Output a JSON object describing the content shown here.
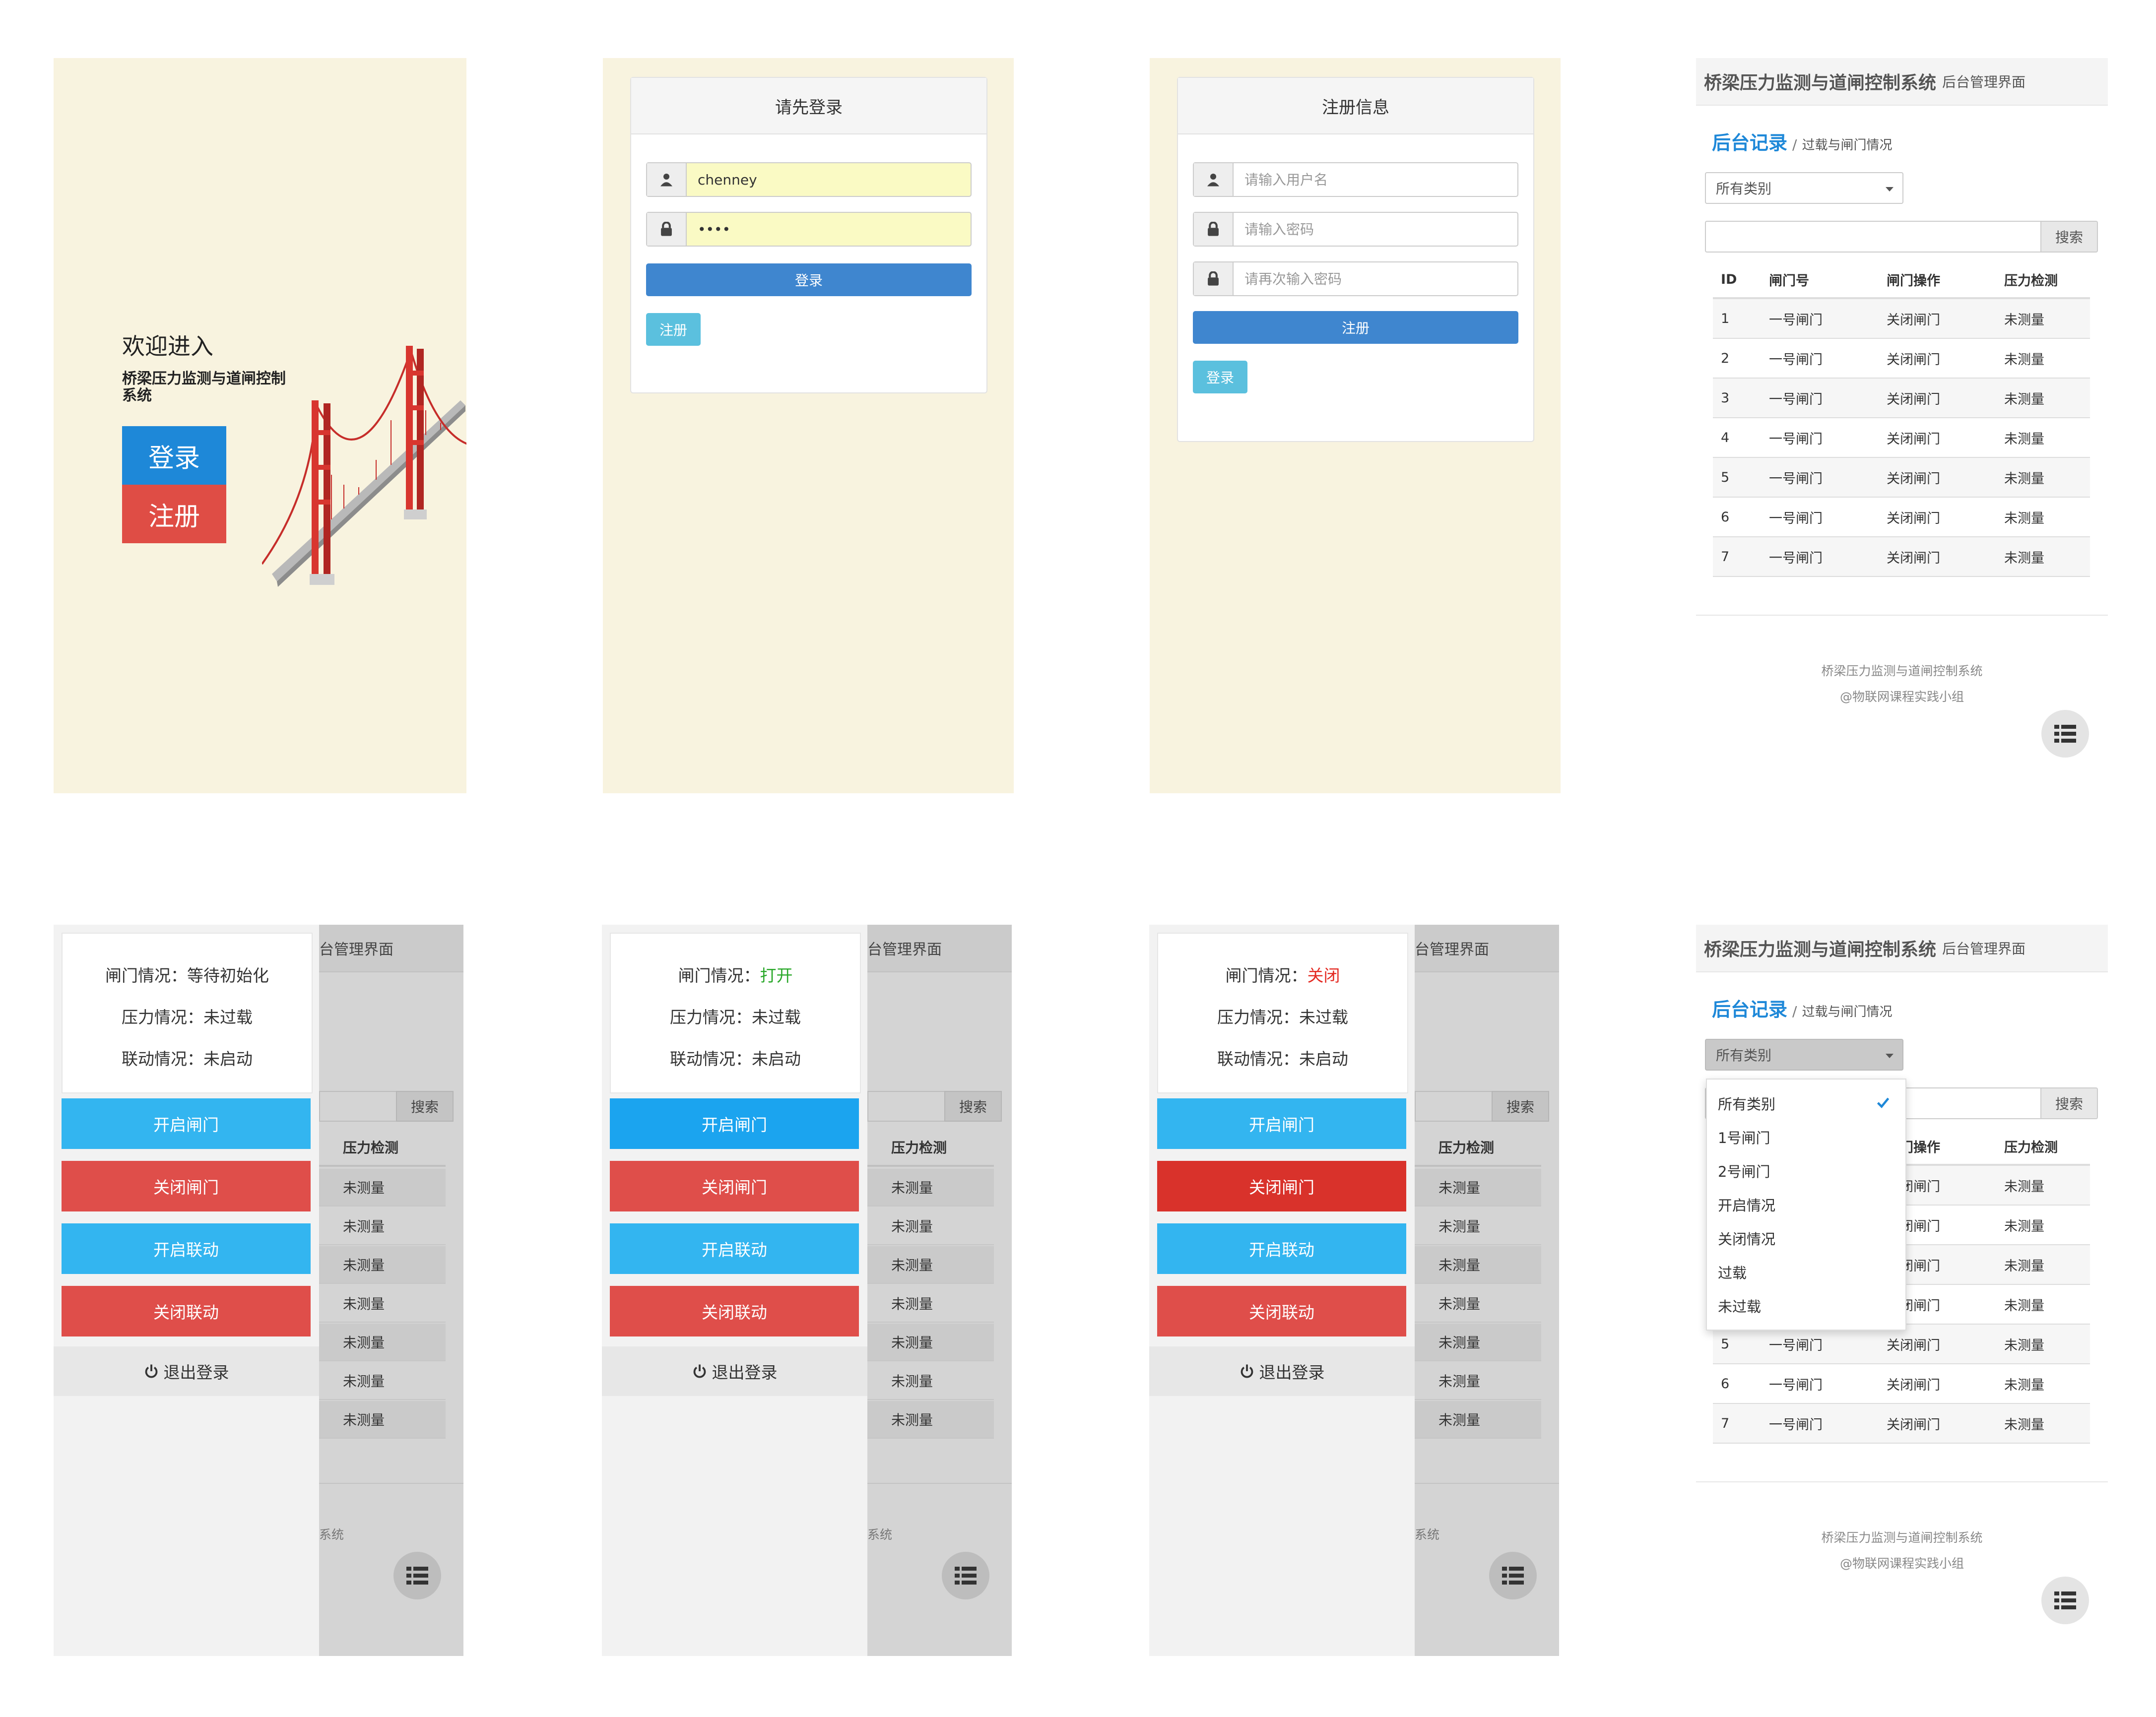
{
  "colors": {
    "accent_blue": "#1e88d8",
    "danger_red": "#df4e4a",
    "cream_bg": "#f8f3df",
    "green_open": "#2aa82a",
    "red_closed": "#e42a22"
  },
  "welcome": {
    "title": "欢迎进入",
    "subtitle": "桥梁压力监测与道闸控制系统",
    "login": "登录",
    "register": "注册"
  },
  "login": {
    "title": "请先登录",
    "user_icon": "user-icon",
    "username": "chenney",
    "password": "••••",
    "submit": "登录",
    "register": "注册"
  },
  "register": {
    "title": "注册信息",
    "username_ph": "请输入用户名",
    "password_ph": "请输入密码",
    "password2_ph": "请再次输入密码",
    "submit": "注册",
    "login": "登录"
  },
  "admin": {
    "app_title": "桥梁压力监测与道闸控制系统",
    "app_sub": "后台管理界面",
    "crumb_main": "后台记录",
    "crumb_sep": "/",
    "crumb_sub": "过载与闸门情况",
    "select_value": "所有类别",
    "search": "搜索",
    "headers": [
      "ID",
      "闸门号",
      "闸门操作",
      "压力检测"
    ],
    "rows": [
      [
        "1",
        "一号闸门",
        "关闭闸门",
        "未测量"
      ],
      [
        "2",
        "一号闸门",
        "关闭闸门",
        "未测量"
      ],
      [
        "3",
        "一号闸门",
        "关闭闸门",
        "未测量"
      ],
      [
        "4",
        "一号闸门",
        "关闭闸门",
        "未测量"
      ],
      [
        "5",
        "一号闸门",
        "关闭闸门",
        "未测量"
      ],
      [
        "6",
        "一号闸门",
        "关闭闸门",
        "未测量"
      ],
      [
        "7",
        "一号闸门",
        "关闭闸门",
        "未测量"
      ]
    ],
    "footer1": "桥梁压力监测与道闸控制系统",
    "footer2": "@物联网课程实践小组",
    "menu_icon": "list-icon"
  },
  "dropdown": {
    "options": [
      "所有类别",
      "1号闸门",
      "2号闸门",
      "开启情况",
      "关闭情况",
      "过载",
      "未过载"
    ],
    "selected_index": 0,
    "partial_row5": [
      "5",
      "一号闸门"
    ]
  },
  "sidebar": {
    "gate_label": "闸门情况：",
    "pressure": "压力情况：未过载",
    "linkage": "联动情况：未启动",
    "states": [
      "等待初始化",
      "打开",
      "关闭"
    ],
    "open_gate": "开启闸门",
    "close_gate": "关闭闸门",
    "open_link": "开启联动",
    "close_link": "关闭联动",
    "logout": "退出登录",
    "bg_header": "台管理界面",
    "bg_search": "搜索",
    "bg_col": "压力检测",
    "bg_cell": "未测量",
    "bg_footer": "系统"
  }
}
